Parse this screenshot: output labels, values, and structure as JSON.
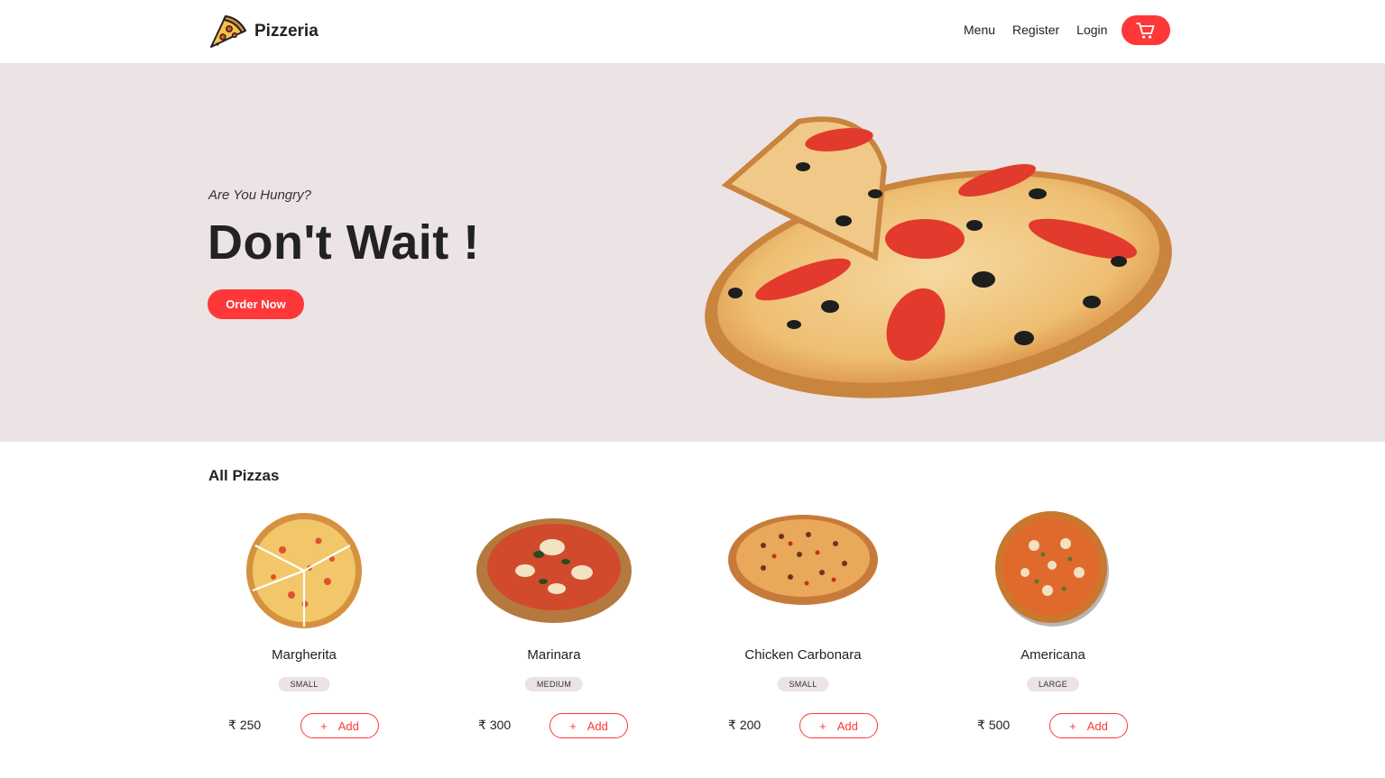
{
  "nav": {
    "brand": "Pizzeria",
    "links": [
      "Menu",
      "Register",
      "Login"
    ],
    "cart_icon": "cart-icon",
    "accent_color": "#fe3838"
  },
  "hero": {
    "kicker": "Are You Hungry?",
    "title": "Don't Wait !",
    "cta": "Order Now",
    "background": "#ece3e4"
  },
  "products": {
    "title": "All Pizzas",
    "items": [
      {
        "name": "Margherita",
        "size": "SMALL",
        "currency": "₹",
        "price": "250",
        "add_label": "Add"
      },
      {
        "name": "Marinara",
        "size": "MEDIUM",
        "currency": "₹",
        "price": "300",
        "add_label": "Add"
      },
      {
        "name": "Chicken Carbonara",
        "size": "SMALL",
        "currency": "₹",
        "price": "200",
        "add_label": "Add"
      },
      {
        "name": "Americana",
        "size": "LARGE",
        "currency": "₹",
        "price": "500",
        "add_label": "Add"
      }
    ]
  }
}
